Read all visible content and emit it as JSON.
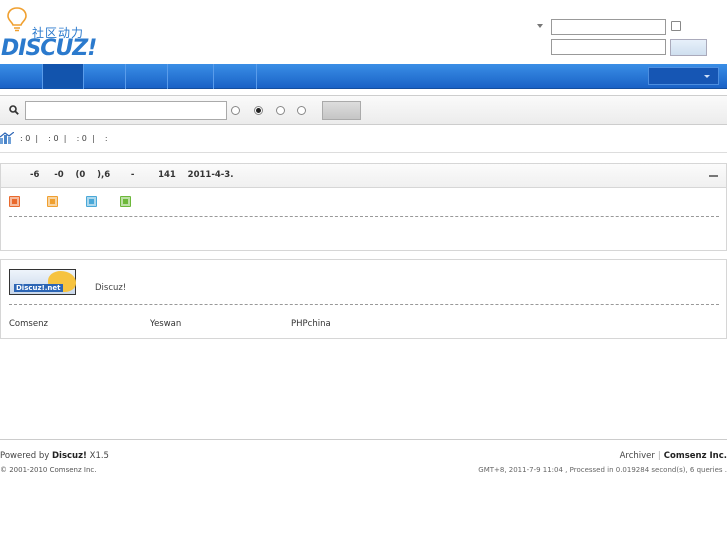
{
  "header": {
    "logo_cn": "社区动力",
    "logo_en": "DISCUZ!"
  },
  "stats": {
    "text": ": 0  |    : 0  |    : 0  |    :"
  },
  "info": {
    "text": "-6     -0    (0    ),6       -        141    2011-4-3."
  },
  "legend_colors": [
    "#E9692C",
    "#F0A030",
    "#4AA8D8",
    "#6CB83A"
  ],
  "friend_links": {
    "logo_text": "Discuz!.net",
    "label": "Discuz!",
    "links": [
      "Comsenz",
      "Yeswan",
      "PHPchina"
    ]
  },
  "footer": {
    "powered_prefix": "Powered by ",
    "powered_brand": "Discuz!",
    "powered_version": " X1.5",
    "copyright": "© 2001-2010 Comsenz Inc.",
    "archiver": "Archiver",
    "company": "Comsenz Inc.",
    "gmt": "GMT+8, 2011-7-9 11:04 , Processed in 0.019284 second(s), 6 queries ."
  },
  "colors": {
    "nav_blue": "#1a62c6",
    "brand_blue": "#2B7ACD"
  }
}
